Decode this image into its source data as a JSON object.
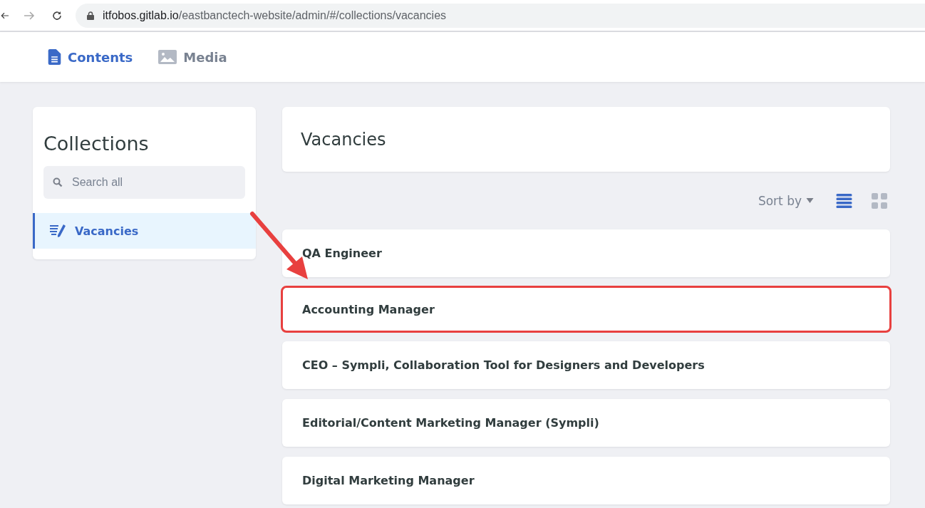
{
  "browser": {
    "url_host": "itfobos.gitlab.io",
    "url_path": "/eastbanctech-website/admin/#/collections/vacancies"
  },
  "nav": {
    "tabs": [
      {
        "label": "Contents",
        "kind": "document",
        "selected": true
      },
      {
        "label": "Media",
        "kind": "image",
        "selected": false
      }
    ]
  },
  "sidebar": {
    "title": "Collections",
    "search": {
      "placeholder": "Search all"
    },
    "items": [
      {
        "label": "Vacancies",
        "selected": true
      }
    ]
  },
  "main": {
    "title": "Vacancies",
    "sort_label": "Sort by",
    "views": [
      {
        "kind": "list",
        "selected": true
      },
      {
        "kind": "grid",
        "selected": false
      }
    ],
    "entries": [
      {
        "title": "QA Engineer",
        "highlighted": false
      },
      {
        "title": "Accounting Manager",
        "highlighted": true
      },
      {
        "title": "CEO – Sympli, Collaboration Tool for Designers and Developers",
        "highlighted": false
      },
      {
        "title": "Editorial/Content Marketing Manager (Sympli)",
        "highlighted": false
      },
      {
        "title": "Digital Marketing Manager",
        "highlighted": false
      }
    ]
  }
}
